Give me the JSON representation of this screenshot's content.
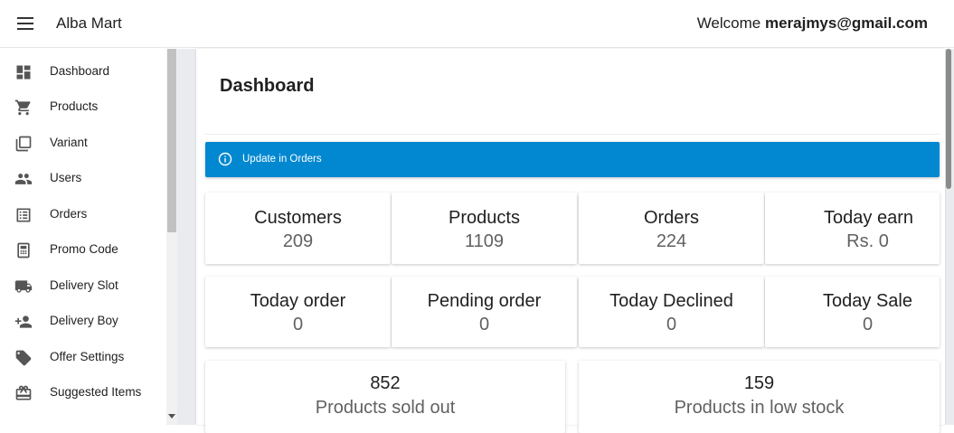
{
  "app": {
    "title": "Alba Mart",
    "welcome_prefix": "Welcome ",
    "user_email": "merajmys@gmail.com"
  },
  "sidebar": {
    "items": [
      {
        "label": "Dashboard",
        "icon": "dashboard-icon"
      },
      {
        "label": "Products",
        "icon": "cart-icon"
      },
      {
        "label": "Variant",
        "icon": "copy-icon"
      },
      {
        "label": "Users",
        "icon": "people-icon"
      },
      {
        "label": "Orders",
        "icon": "list-icon"
      },
      {
        "label": "Promo Code",
        "icon": "receipt-icon"
      },
      {
        "label": "Delivery Slot",
        "icon": "truck-icon"
      },
      {
        "label": "Delivery Boy",
        "icon": "person-add-icon"
      },
      {
        "label": "Offer Settings",
        "icon": "tag-icon"
      },
      {
        "label": "Suggested Items",
        "icon": "gift-icon"
      }
    ]
  },
  "main": {
    "title": "Dashboard",
    "alert": {
      "text": "Update in Orders",
      "color": "#0288d1"
    },
    "stats_row1": [
      {
        "label": "Customers",
        "value": "209"
      },
      {
        "label": "Products",
        "value": "1109"
      },
      {
        "label": "Orders",
        "value": "224"
      },
      {
        "label": "Today earn",
        "value": "Rs. 0"
      }
    ],
    "stats_row2": [
      {
        "label": "Today order",
        "value": "0"
      },
      {
        "label": "Pending order",
        "value": "0"
      },
      {
        "label": "Today Declined",
        "value": "0"
      },
      {
        "label": "Today Sale",
        "value": "0"
      }
    ],
    "stats_row3": [
      {
        "label": "Products sold out",
        "value": "852"
      },
      {
        "label": "Products in low stock",
        "value": "159"
      }
    ]
  }
}
